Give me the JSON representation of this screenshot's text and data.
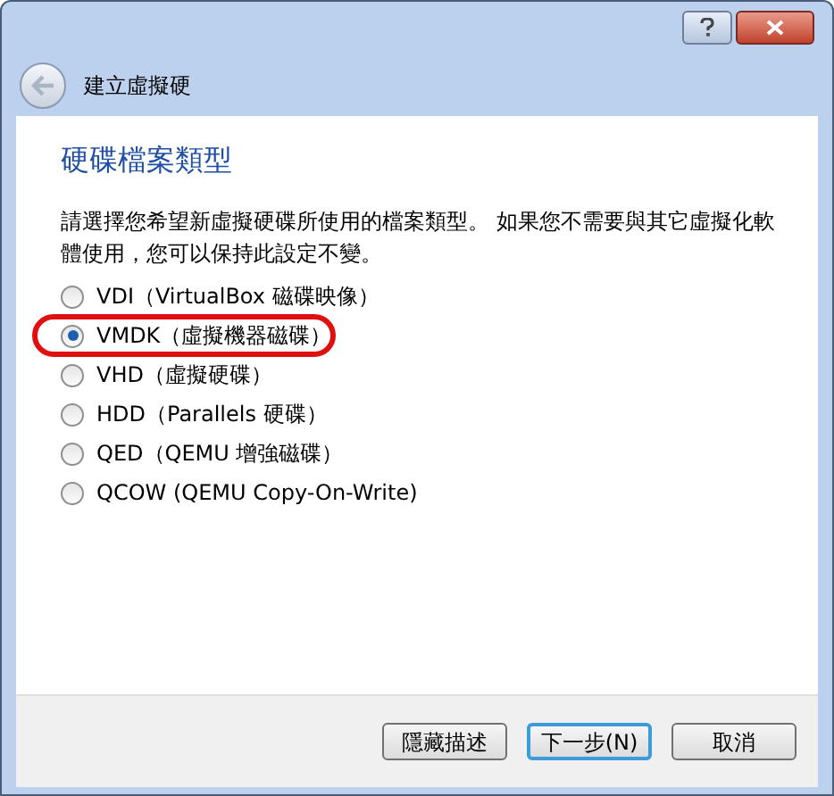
{
  "window": {
    "title": "建立虛擬硬"
  },
  "heading": "硬碟檔案類型",
  "description": "請選擇您希望新虛擬硬碟所使用的檔案類型。 如果您不需要與其它虛擬化軟體使用，您可以保持此設定不變。",
  "options": [
    {
      "label": "VDI（VirtualBox 磁碟映像）",
      "selected": false,
      "highlighted": false
    },
    {
      "label": "VMDK（虛擬機器磁碟）",
      "selected": true,
      "highlighted": true
    },
    {
      "label": "VHD（虛擬硬碟）",
      "selected": false,
      "highlighted": false
    },
    {
      "label": "HDD（Parallels 硬碟）",
      "selected": false,
      "highlighted": false
    },
    {
      "label": "QED（QEMU 增強磁碟）",
      "selected": false,
      "highlighted": false
    },
    {
      "label": "QCOW (QEMU Copy-On-Write)",
      "selected": false,
      "highlighted": false
    }
  ],
  "buttons": [
    {
      "label": "隱藏描述",
      "default": false
    },
    {
      "label": "下一步(N)",
      "default": true
    },
    {
      "label": "取消",
      "default": false
    }
  ]
}
